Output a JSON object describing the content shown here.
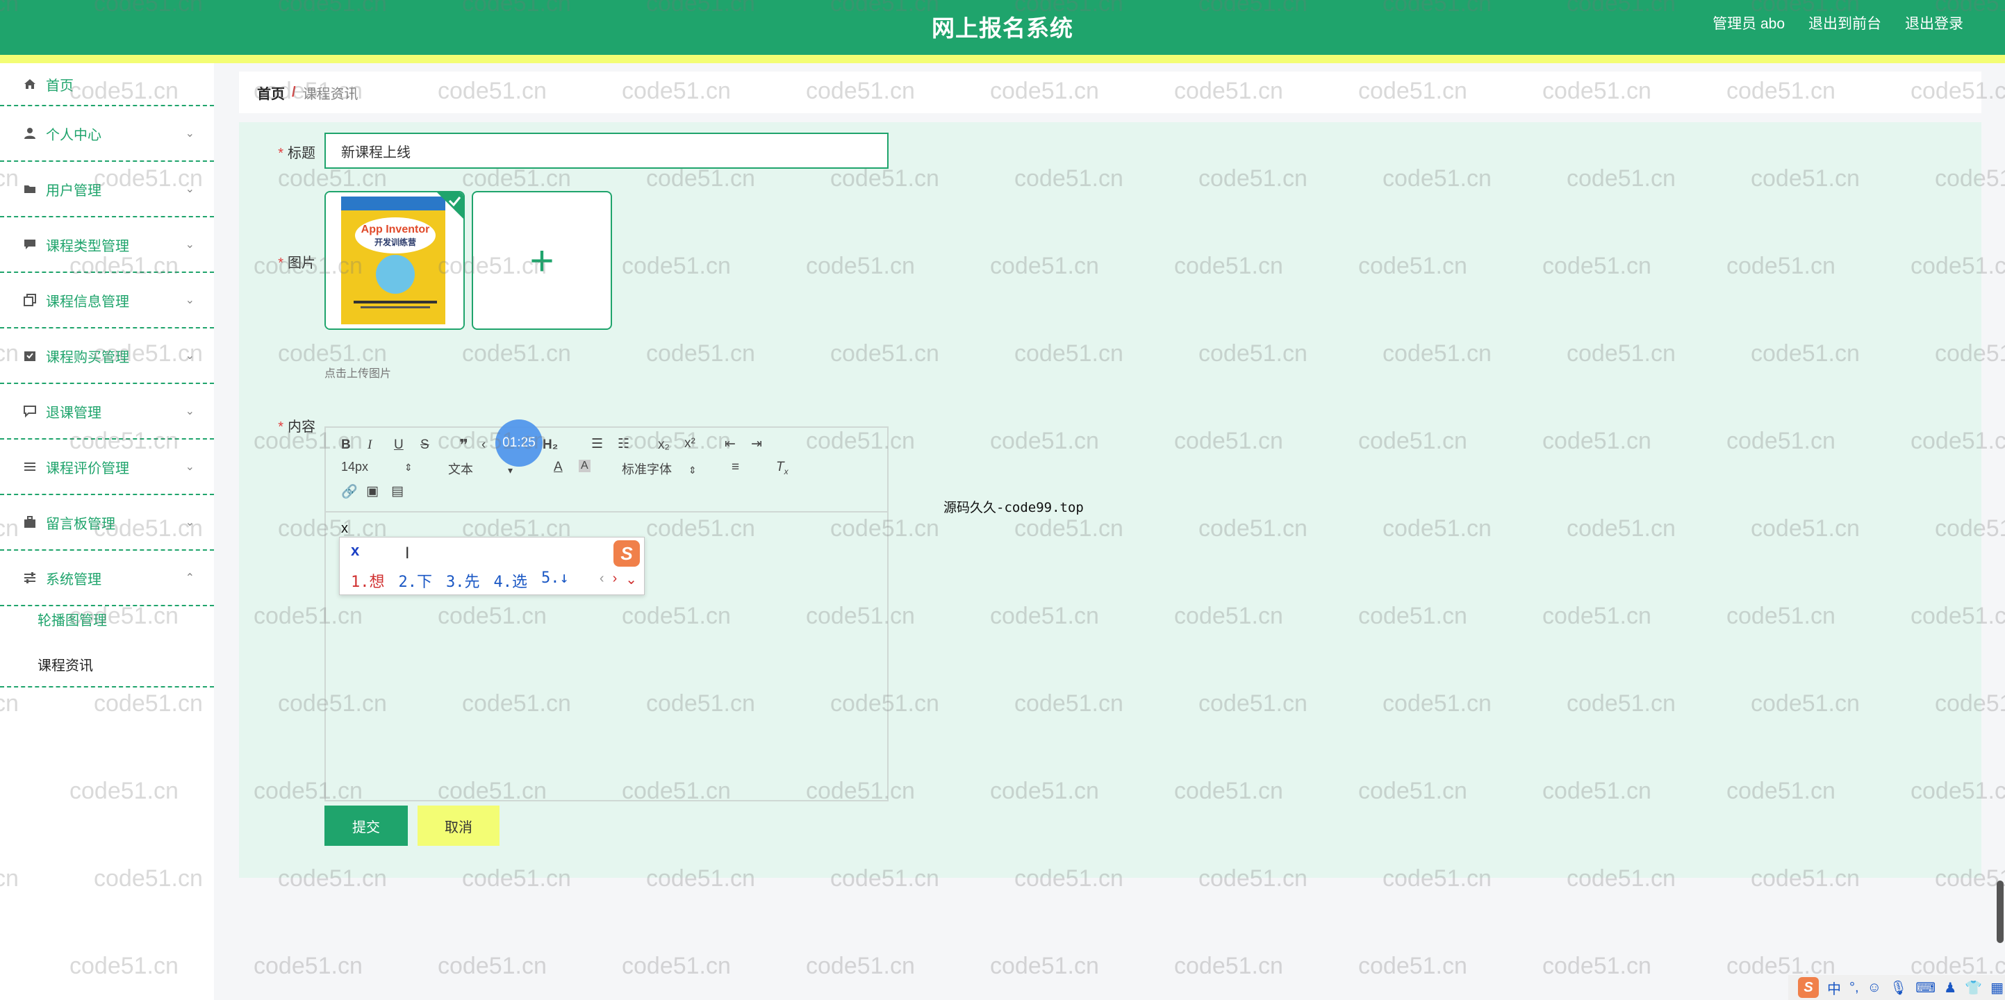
{
  "header": {
    "title": "网上报名系统",
    "user_label": "管理员 abo",
    "front_link": "退出到前台",
    "logout_link": "退出登录"
  },
  "sidebar": {
    "items": [
      {
        "label": "首页",
        "icon": "home-icon"
      },
      {
        "label": "个人中心",
        "icon": "user-icon"
      },
      {
        "label": "用户管理",
        "icon": "folder-icon"
      },
      {
        "label": "课程类型管理",
        "icon": "chat-icon"
      },
      {
        "label": "课程信息管理",
        "icon": "copy-icon"
      },
      {
        "label": "课程购买管理",
        "icon": "box-icon"
      },
      {
        "label": "退课管理",
        "icon": "message-icon"
      },
      {
        "label": "课程评价管理",
        "icon": "list-icon"
      },
      {
        "label": "留言板管理",
        "icon": "briefcase-icon"
      },
      {
        "label": "系统管理",
        "icon": "sliders-icon"
      }
    ],
    "sub_items": [
      {
        "label": "轮播图管理"
      },
      {
        "label": "课程资讯"
      }
    ]
  },
  "breadcrumb": {
    "home": "首页",
    "separator": "/",
    "current": "课程资讯"
  },
  "form": {
    "title_label": "标题",
    "title_value": "新课程上线",
    "image_label": "图片",
    "upload_hint": "点击上传图片",
    "book_cover_text": "App Inventor 开发训练营",
    "content_label": "内容",
    "submit_label": "提交",
    "cancel_label": "取消"
  },
  "editor": {
    "font_size": "14px",
    "paragraph": "文本",
    "font_family": "标准字体",
    "heading": "H₂",
    "content_text": "x"
  },
  "ime": {
    "input": "x",
    "candidates": [
      "1.想",
      "2.下",
      "3.先",
      "4.选",
      "5.↓"
    ]
  },
  "overlay": {
    "timer": "01:25",
    "source_text": "源码久久-code99.top"
  },
  "watermark": "code51.cn",
  "tray": {
    "lang": "中"
  },
  "colors": {
    "primary": "#1fa46c",
    "accent_yellow": "#f3fd74",
    "panel_bg": "#e5f6ef",
    "required": "#e24040"
  }
}
